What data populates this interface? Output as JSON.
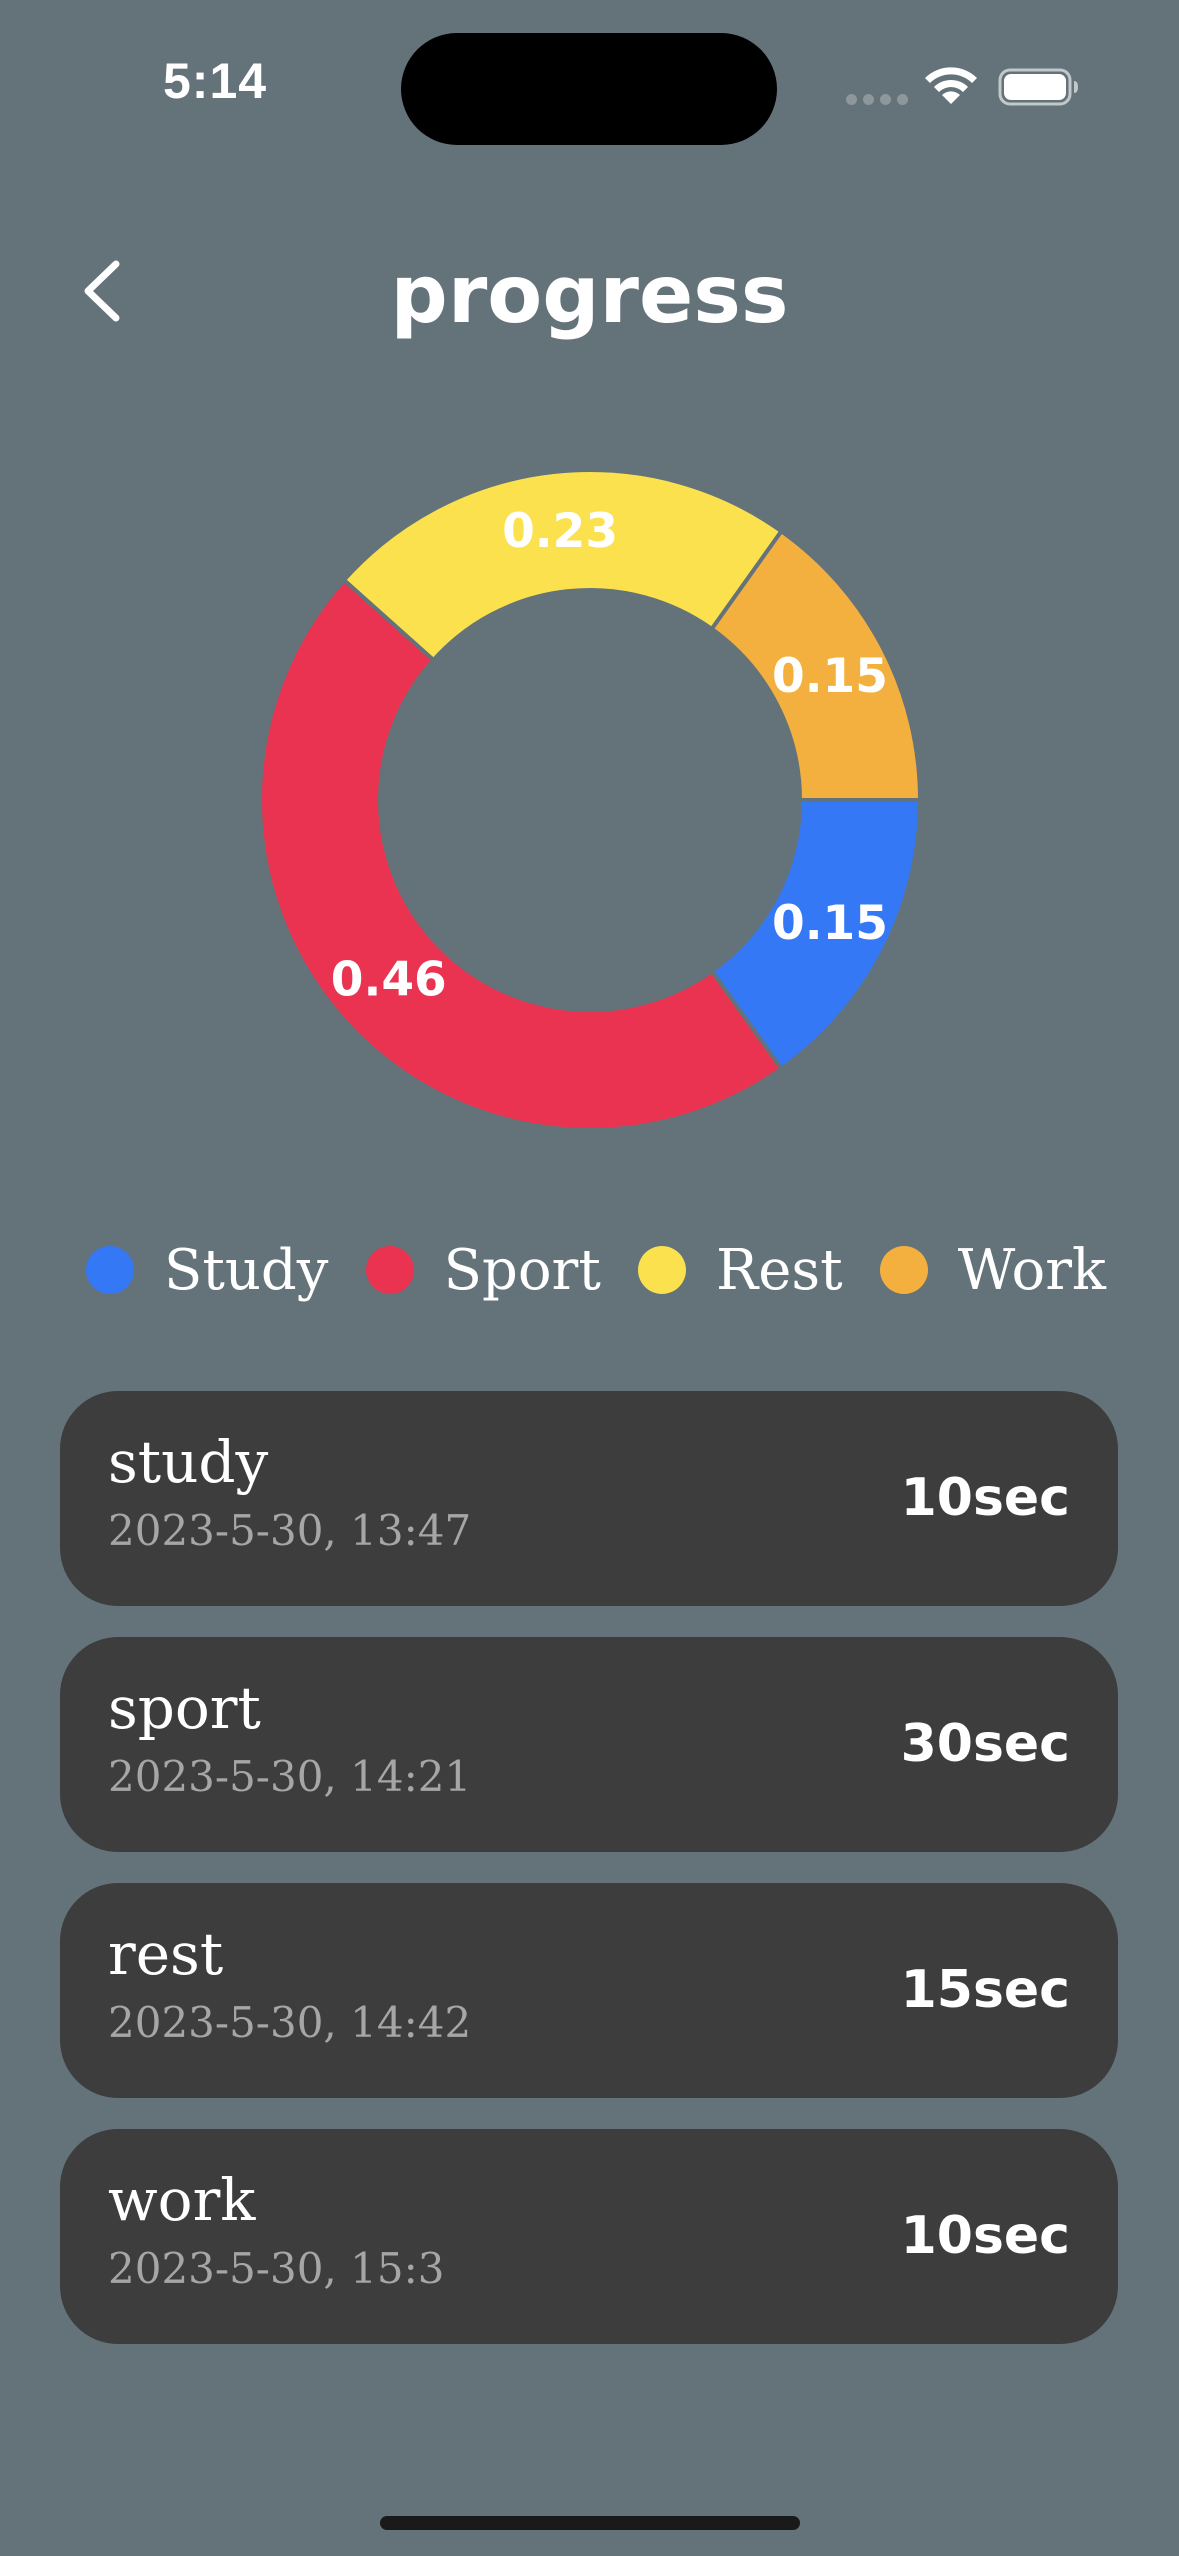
{
  "status_bar": {
    "time": "5:14"
  },
  "header": {
    "title": "progress",
    "back_icon": "chevron-left-icon"
  },
  "chart_data": {
    "type": "pie",
    "variant": "donut",
    "categories": [
      "Study",
      "Sport",
      "Rest",
      "Work"
    ],
    "values": [
      0.15,
      0.46,
      0.23,
      0.15
    ],
    "labels": [
      "0.15",
      "0.46",
      "0.23",
      "0.15"
    ],
    "colors": [
      "#3478f6",
      "#ea3350",
      "#fbe14e",
      "#f3b03f"
    ],
    "legend": "bottom"
  },
  "legend": [
    {
      "label": "Study",
      "color": "#3478f6"
    },
    {
      "label": "Sport",
      "color": "#ea3350"
    },
    {
      "label": "Rest",
      "color": "#fbe14e"
    },
    {
      "label": "Work",
      "color": "#f3b03f"
    }
  ],
  "records": [
    {
      "name": "study",
      "date": "2023-5-30, 13:47",
      "duration": "10sec"
    },
    {
      "name": "sport",
      "date": "2023-5-30, 14:21",
      "duration": "30sec"
    },
    {
      "name": "rest",
      "date": "2023-5-30, 14:42",
      "duration": "15sec"
    },
    {
      "name": "work",
      "date": "2023-5-30, 15:3",
      "duration": "10sec"
    }
  ]
}
